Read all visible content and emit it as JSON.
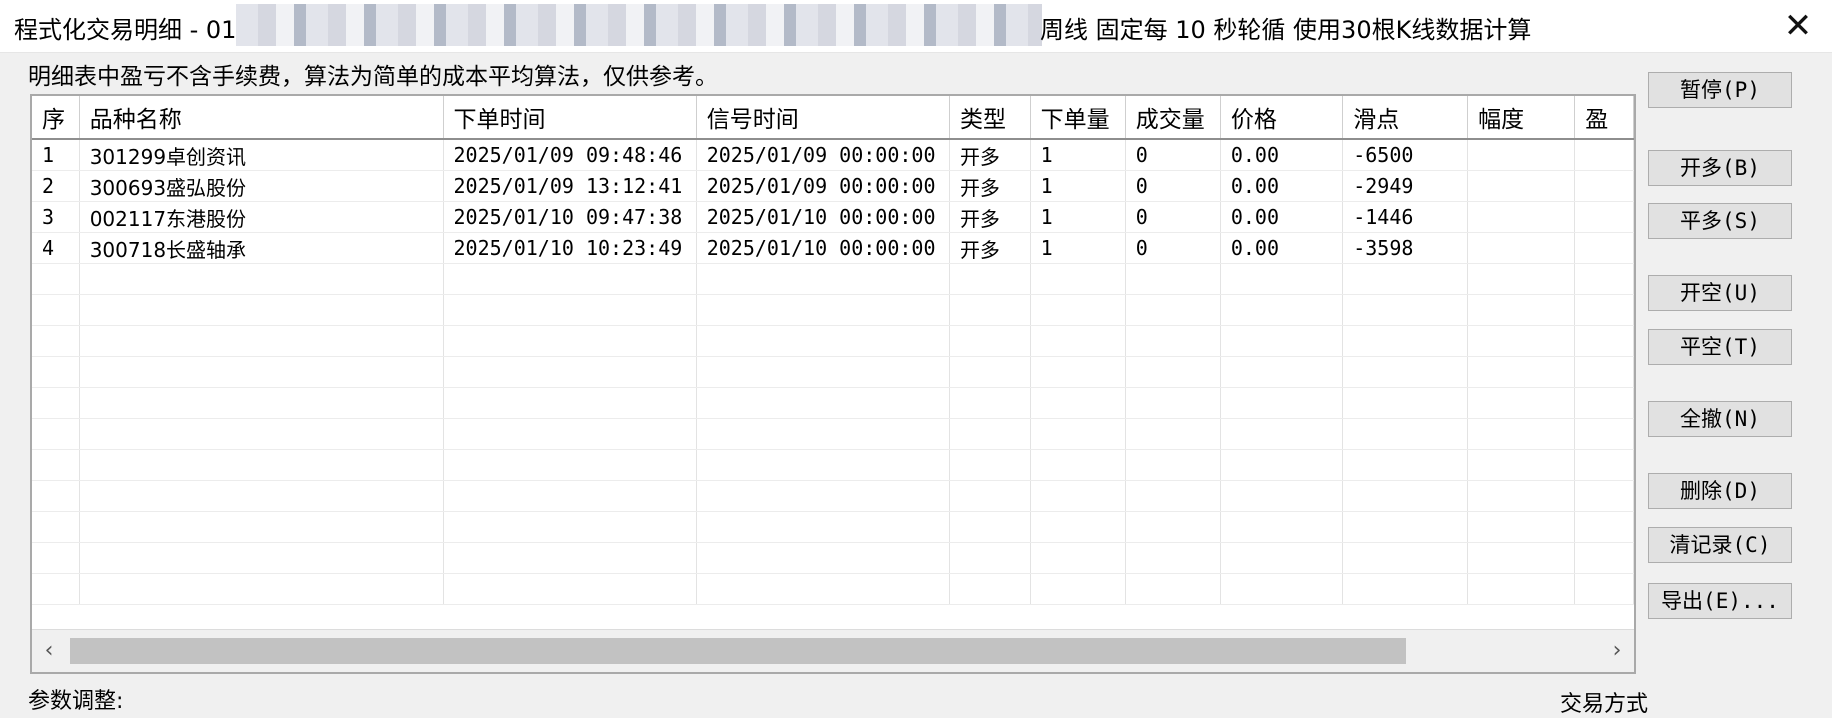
{
  "window": {
    "title_left": "程式化交易明细 - 01",
    "title_right": "周线 固定每 10 秒轮循 使用30根K线数据计算",
    "close_label": "✕"
  },
  "note": "明细表中盈亏不含手续费，算法为简单的成本平均算法，仅供参考。",
  "table": {
    "headers": [
      "序",
      "品种名称",
      "下单时间",
      "信号时间",
      "类型",
      "下单量",
      "成交量",
      "价格",
      "滑点",
      "幅度",
      "盈"
    ],
    "rows": [
      [
        "1",
        "301299卓创资讯",
        "2025/01/09 09:48:46",
        "2025/01/09 00:00:00",
        "开多",
        "1",
        "0",
        "0.00",
        "-6500",
        "",
        ""
      ],
      [
        "2",
        "300693盛弘股份",
        "2025/01/09 13:12:41",
        "2025/01/09 00:00:00",
        "开多",
        "1",
        "0",
        "0.00",
        "-2949",
        "",
        ""
      ],
      [
        "3",
        "002117东港股份",
        "2025/01/10 09:47:38",
        "2025/01/10 00:00:00",
        "开多",
        "1",
        "0",
        "0.00",
        "-1446",
        "",
        ""
      ],
      [
        "4",
        "300718长盛轴承",
        "2025/01/10 10:23:49",
        "2025/01/10 00:00:00",
        "开多",
        "1",
        "0",
        "0.00",
        "-3598",
        "",
        ""
      ]
    ]
  },
  "scrollbar": {
    "left_arrow": "‹",
    "right_arrow": "›"
  },
  "buttons": {
    "pause": "暂停(P)",
    "open_long": "开多(B)",
    "close_long": "平多(S)",
    "open_short": "开空(U)",
    "close_short": "平空(T)",
    "cancel_all": "全撤(N)",
    "delete": "删除(D)",
    "clear": "清记录(C)",
    "export": "导出(E)..."
  },
  "bottom": {
    "left_label": "参数调整:",
    "right_label": "交易方式"
  }
}
